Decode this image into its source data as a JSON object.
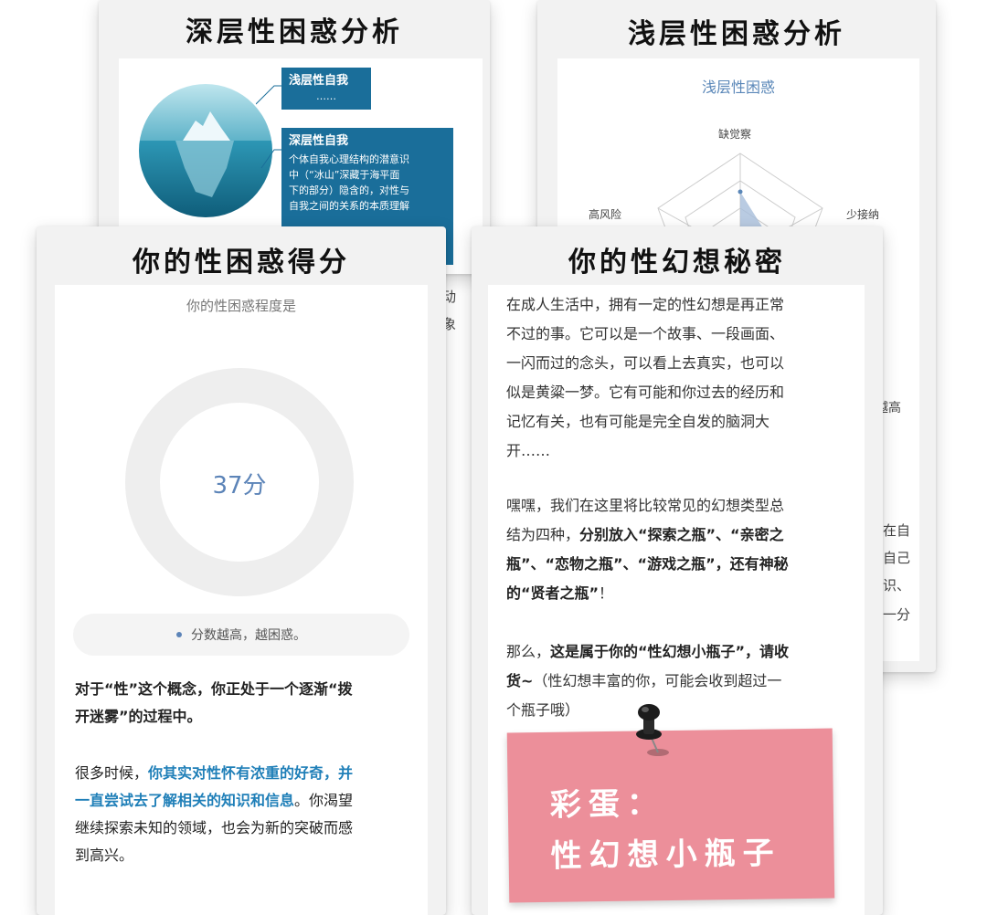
{
  "deep_card": {
    "title": "深层性困惑分析",
    "shallow_box_title": "浅层性自我",
    "shallow_box_text": "……",
    "deep_box_title": "深层性自我",
    "deep_box_lines": [
      "个体自我心理结构的潜意识",
      "中（“冰山”深藏于海平面",
      "下的部分）隐含的，对性与",
      "自我之间的关系的本质理解"
    ],
    "fragments": [
      "动",
      "象"
    ]
  },
  "shallow_card": {
    "title": "浅层性困惑分析",
    "radar_title": "浅层性困惑",
    "axis_labels": {
      "top": "缺觉察",
      "left": "高风险",
      "right": "少接纳"
    },
    "fragments": [
      "越高",
      "在自",
      "自己",
      "识、",
      "一分"
    ]
  },
  "score_card": {
    "title": "你的性困惑得分",
    "subtitle": "你的性困惑程度是",
    "score_label": "37分",
    "score_value": 37,
    "score_max": 100,
    "legend": "分数越高，越困惑。",
    "p1_line1": "对于“性”这个概念，你正处于一个逐渐“拨",
    "p1_line2": "开迷雾”的过程中。",
    "p2_line1_plain": "很多时候，",
    "p2_line1_hl": "你其实对性怀有浓重的好奇，并",
    "p2_line2_hl": "一直尝试去了解相关的知识和信息",
    "p2_line2_plain": "。你渴望",
    "p2_line3": "继续探索未知的领域，也会为新的突破而感",
    "p2_line4": "到高兴。"
  },
  "fantasy_card": {
    "title": "你的性幻想秘密",
    "p1_lines": [
      "在成人生活中，拥有一定的性幻想是再正常",
      "不过的事。它可以是一个故事、一段画面、",
      "一闪而过的念头，可以看上去真实，也可以",
      "似是黄粱一梦。它有可能和你过去的经历和",
      "记忆有关，也有可能是完全自发的脑洞大",
      "开……"
    ],
    "p2_line1": "嘿嘿，我们在这里将比较常见的幻想类型总",
    "p2_line2_plain": "结为四种，",
    "p2_line2_bold": "分别放入“探索之瓶”、“亲密之",
    "p2_line3_bold": "瓶”、“恋物之瓶”、“游戏之瓶”，还有神秘",
    "p2_line4_bold": "的“贤者之瓶”",
    "p2_line4_plain": "！",
    "p3_line1_plain": "那么，",
    "p3_line1_bold": "这是属于你的“性幻想小瓶子”，请收",
    "p3_line2_bold": "货~",
    "p3_line2_plain": "（性幻想丰富的你，可能会收到超过一",
    "p3_line3": "个瓶子哦）",
    "sticky_line1": "彩蛋：",
    "sticky_line2": "性幻想小瓶子"
  },
  "colors": {
    "accent": "#1a6e9a",
    "donut_fill": "#6d93c2",
    "donut_track": "#eeeeee",
    "sticky": "#ec8f9a",
    "highlight_text": "#1f7fb8"
  }
}
